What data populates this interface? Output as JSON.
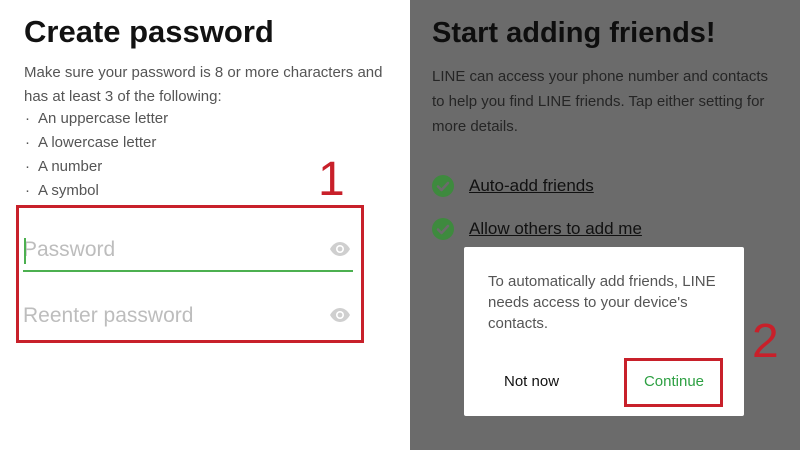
{
  "left_screen": {
    "title": "Create password",
    "description": "Make sure your password is 8 or more characters and has at least 3 of the following:",
    "requirements": [
      "An uppercase letter",
      "A lowercase letter",
      "A number",
      "A symbol"
    ],
    "bullet_char": "·",
    "password_placeholder": "Password",
    "reenter_placeholder": "Reenter password",
    "eye_icon": "eye-icon"
  },
  "right_screen": {
    "title": "Start adding friends!",
    "description": "LINE can access your phone number and contacts to help you find LINE friends. Tap either setting for more details.",
    "options": [
      {
        "label": "Auto-add friends",
        "icon": "check-circle-icon"
      },
      {
        "label": "Allow others to add me",
        "icon": "check-circle-icon"
      }
    ],
    "dialog": {
      "message": "To automatically add friends, LINE needs access to your device's contacts.",
      "not_now": "Not now",
      "continue": "Continue"
    }
  },
  "annotations": {
    "step1": "1",
    "step2": "2",
    "highlight_color": "#c8202a"
  },
  "colors": {
    "accent_green": "#2ea043",
    "check_green": "#3e8a3e",
    "overlay_gray": "#6b6b6b"
  }
}
